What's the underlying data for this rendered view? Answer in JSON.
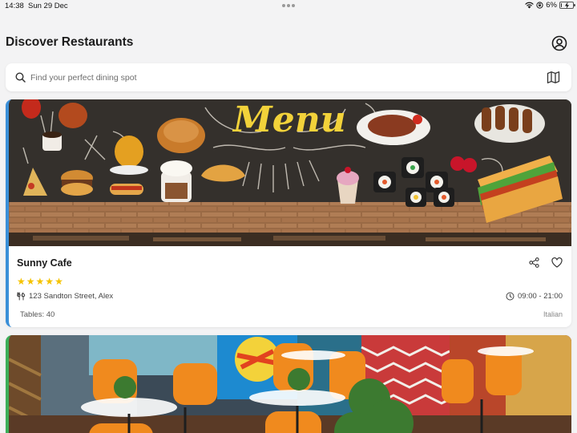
{
  "status_bar": {
    "time": "14:38",
    "date": "Sun 29 Dec",
    "battery_percent": "6%",
    "battery_level": 0.06
  },
  "header": {
    "title": "Discover Restaurants",
    "profile_icon": "user-circle-icon"
  },
  "search": {
    "placeholder": "Find your perfect dining spot",
    "value": "",
    "search_icon": "magnifier-icon",
    "map_icon": "map-icon"
  },
  "restaurants": [
    {
      "name": "Sunny Cafe",
      "rating": 5,
      "stars": "★★★★★",
      "address": "123 Sandton Street, Alex",
      "hours": "09:00 - 21:00",
      "tables": "Tables: 40",
      "cuisine": "Italian",
      "accent": "#3a8fd8",
      "image_text": "Menu"
    },
    {
      "accent": "#3cae58"
    }
  ],
  "colors": {
    "star": "#f5c300",
    "background": "#f3f3f4",
    "card": "#ffffff"
  }
}
